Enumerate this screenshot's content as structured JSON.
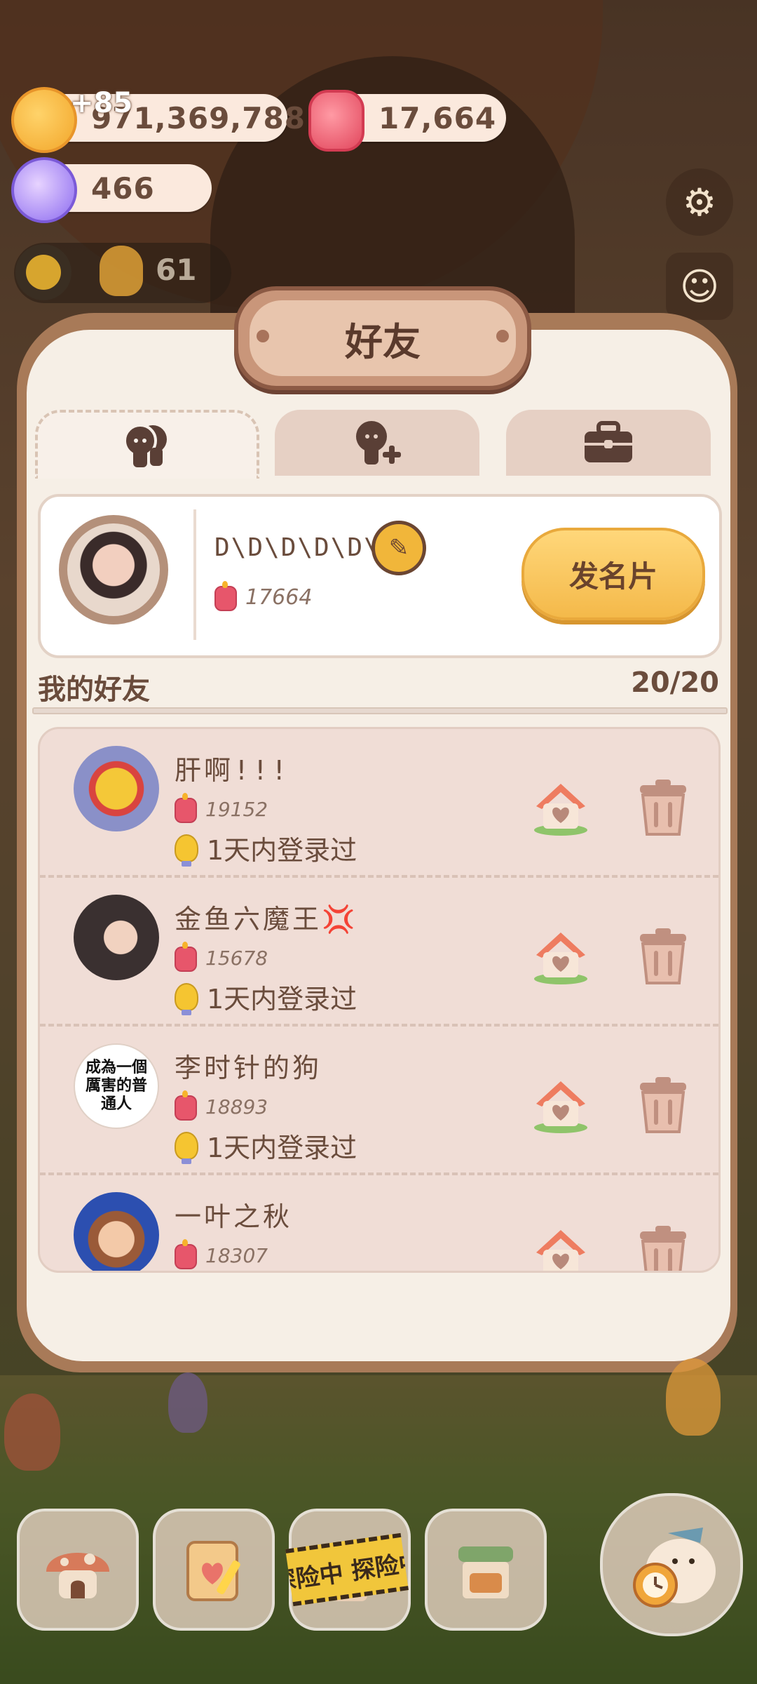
{
  "currencies": {
    "coins": "971,369,788",
    "coins_gain": "+85",
    "candles": "17,664",
    "candy": "466"
  },
  "level": {
    "value": "61"
  },
  "dialog": {
    "title": "好友",
    "tabs": [
      {
        "name": "friends",
        "icon": "friends-icon"
      },
      {
        "name": "add-friend",
        "icon": "add-friend-icon"
      },
      {
        "name": "bag",
        "icon": "briefcase-icon"
      }
    ]
  },
  "my_card": {
    "name": "D\\D\\D\\D\\D\\",
    "count": "17664",
    "send_button": "发名片"
  },
  "friends_section": {
    "title": "我的好友",
    "count": "20/20"
  },
  "friends": [
    {
      "name": "肝啊!!!",
      "count": "19152",
      "status": "1天内登录过",
      "avatar_color": "#8a90c8"
    },
    {
      "name": "金鱼六魔王💢",
      "count": "15678",
      "status": "1天内登录过",
      "avatar_color": "#3a3030"
    },
    {
      "name": "李时针的狗",
      "count": "18893",
      "status": "1天内登录过",
      "avatar_color": "#ffffff",
      "avatar_text": "成為一個厲害的普通人"
    },
    {
      "name": "一叶之秋",
      "count": "18307",
      "status": "",
      "avatar_color": "#2c4fb0"
    }
  ],
  "bottom_nav": {
    "adventure_tape": "探险中 探险中"
  },
  "colors": {
    "panel_bg": "#f6efe6",
    "list_bg": "#f0ddd6",
    "accent_button": "#f4b94a",
    "text_brown": "#6a4c3c"
  }
}
